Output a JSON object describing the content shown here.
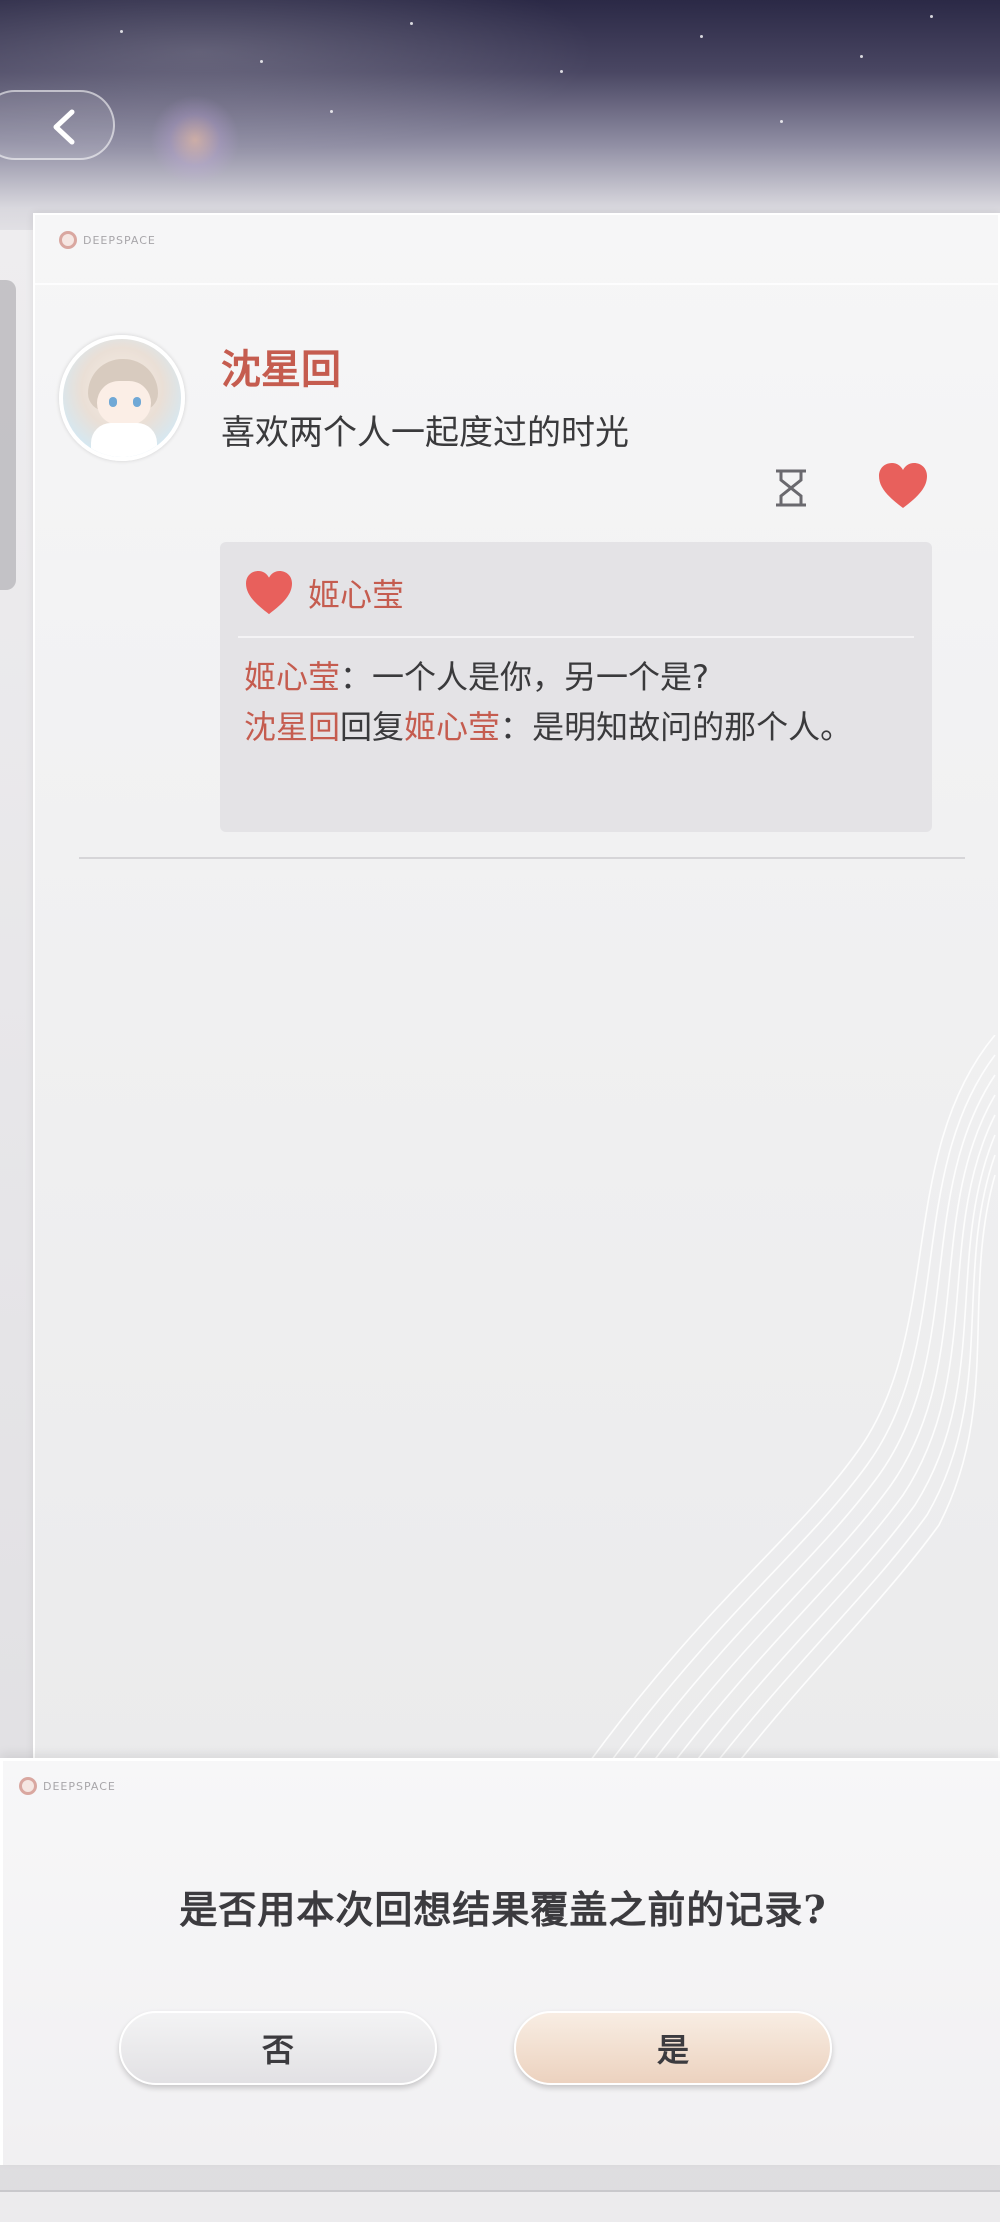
{
  "header": {
    "back_icon": "chevron-left-icon"
  },
  "card": {
    "brand": "DEEPSPACE",
    "post": {
      "author": "沈星回",
      "text": "喜欢两个人一起度过的时光",
      "actions": {
        "timer_icon": "hourglass-icon",
        "like_icon": "heart-icon",
        "like_color": "#e8605c"
      },
      "likes": {
        "names": "姬心莹"
      },
      "comments": [
        {
          "author": "姬心莹",
          "sep": "：",
          "text": "一个人是你，另一个是?"
        },
        {
          "author": "沈星回",
          "reply_word": "回复",
          "reply_to": "姬心莹",
          "sep": "：",
          "text": "是明知故问的那个人。"
        }
      ]
    }
  },
  "dialog": {
    "brand": "DEEPSPACE",
    "title": "是否用本次回想结果覆盖之前的记录?",
    "no_label": "否",
    "yes_label": "是"
  },
  "colors": {
    "accent_name": "#c55c4f",
    "heart": "#e8605c",
    "yes_button": "#ecd2bf"
  }
}
